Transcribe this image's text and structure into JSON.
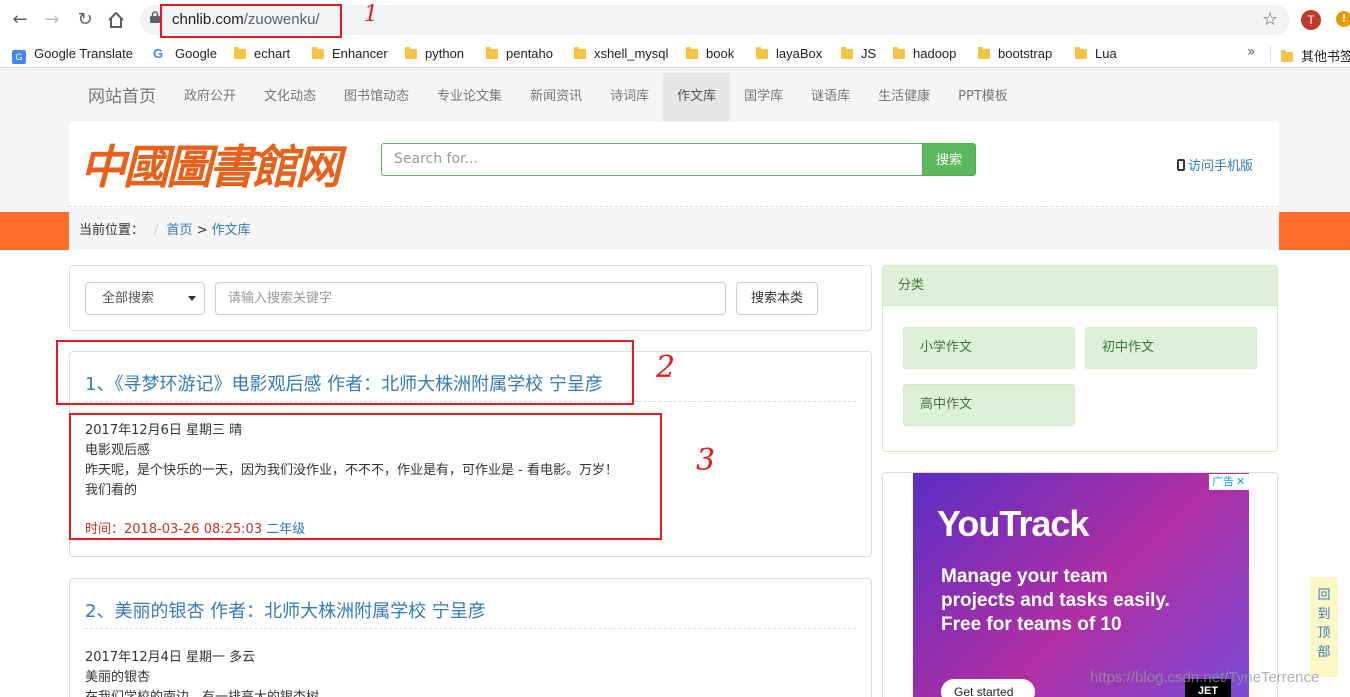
{
  "browser": {
    "url_host": "chnlib.com",
    "url_path": "/zuowenku/",
    "avatar_letter": "T",
    "alert_glyph": "!",
    "bookmarks": [
      "Google Translate",
      "Google",
      "echart",
      "Enhancer",
      "python",
      "pentaho",
      "xshell_mysql",
      "book",
      "layaBox",
      "JS",
      "hadoop",
      "bootstrap",
      "Lua"
    ],
    "bookmarks_more": "»",
    "other_bookmarks": "其他书签"
  },
  "site": {
    "nav": [
      "网站首页",
      "政府公开",
      "文化动态",
      "图书馆动态",
      "专业论文集",
      "新闻资讯",
      "诗词库",
      "作文库",
      "国学库",
      "谜语库",
      "生活健康",
      "PPT模板"
    ],
    "active_nav": "作文库",
    "logo_text": "中國圖書館网",
    "search_placeholder": "Search for...",
    "search_button": "搜索",
    "mobile_link": "访问手机版",
    "breadcrumb": {
      "label": "当前位置：",
      "separator": "/",
      "home": "首页",
      "arrow": ">",
      "current": "作文库"
    }
  },
  "filter": {
    "select_value": "全部搜索",
    "keyword_placeholder": "请输入搜索关键字",
    "button": "搜索本类"
  },
  "articles": [
    {
      "title": "1、《寻梦环游记》电影观后感 作者：北师大株洲附属学校 宁呈彦",
      "lines": [
        "2017年12月6日 星期三 晴",
        "电影观后感",
        "昨天呢，是个快乐的一天，因为我们没作业，不不不，作业是有，可作业是 - 看电影。万岁！",
        "我们看的"
      ],
      "time_label": "时间：",
      "time_value": "2018-03-26 08:25:03",
      "grade": "二年级"
    },
    {
      "title": "2、美丽的银杏 作者：北师大株洲附属学校 宁呈彦",
      "lines": [
        "2017年12月4日 星期一 多云",
        "美丽的银杏",
        "在我们学校的南边，有一排高大的银杏树"
      ]
    }
  ],
  "category": {
    "heading": "分类",
    "items": [
      "小学作文",
      "初中作文",
      "高中作文"
    ]
  },
  "ad": {
    "badge": "广告",
    "close": "✕",
    "logo": "YouTrack",
    "copy": [
      "Manage your team",
      "projects and tasks easily.",
      "Free for teams of 10"
    ],
    "cta": "Get started",
    "brand": "JET"
  },
  "back_to_top": [
    "回",
    "到",
    "顶",
    "部"
  ],
  "annotations": {
    "marker_1": "1",
    "marker_2": "2",
    "marker_3": "3"
  },
  "watermark": "https://blog.csdn.net/TyneTerrence",
  "colors": {
    "accent_orange": "#ff6d2c",
    "link_blue": "#337ab7",
    "green": "#5cb85c",
    "annotation_red": "#e8181e"
  }
}
